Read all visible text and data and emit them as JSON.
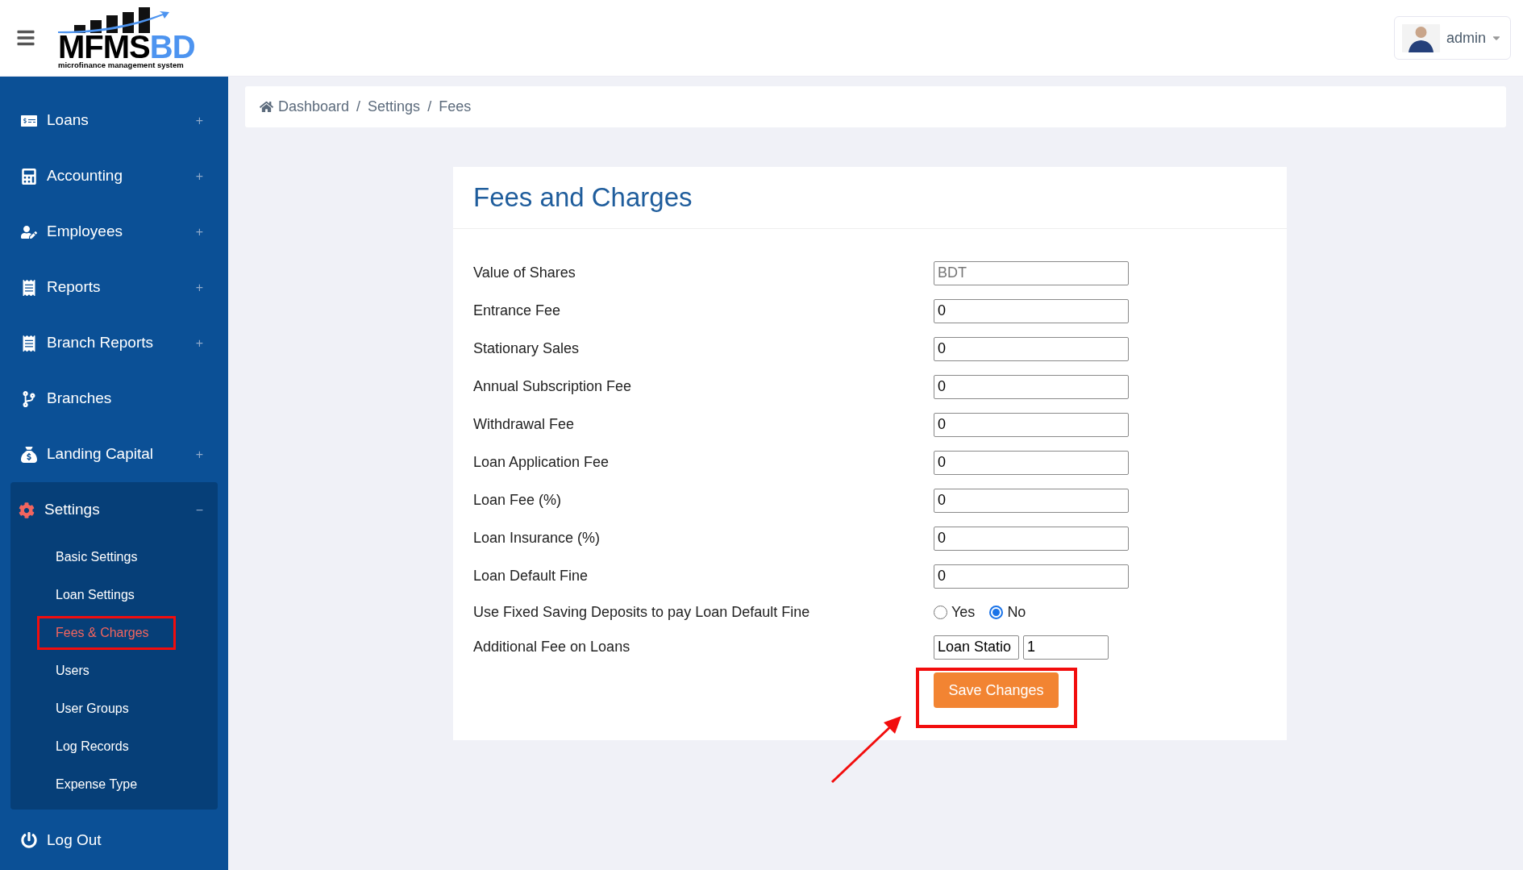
{
  "logo": {
    "name_dark": "MFMS",
    "name_accent": "BD",
    "tagline": "microfinance management system"
  },
  "user": {
    "name": "admin"
  },
  "sidebar": {
    "items": [
      {
        "label": "Loans",
        "toggle": "+",
        "expanded": false
      },
      {
        "label": "Accounting",
        "toggle": "+",
        "expanded": false
      },
      {
        "label": "Employees",
        "toggle": "+",
        "expanded": false
      },
      {
        "label": "Reports",
        "toggle": "+",
        "expanded": false
      },
      {
        "label": "Branch Reports",
        "toggle": "+",
        "expanded": false
      },
      {
        "label": "Branches",
        "expanded": false
      },
      {
        "label": "Landing Capital",
        "toggle": "+",
        "expanded": false
      },
      {
        "label": "Settings",
        "toggle": "−",
        "expanded": true,
        "children": [
          {
            "label": "Basic Settings",
            "selected": false,
            "highlighted": false
          },
          {
            "label": "Loan Settings",
            "selected": false,
            "highlighted": false
          },
          {
            "label": "Fees & Charges",
            "selected": true,
            "highlighted": true
          },
          {
            "label": "Users",
            "selected": false,
            "highlighted": false
          },
          {
            "label": "User Groups",
            "selected": false,
            "highlighted": false
          },
          {
            "label": "Log Records",
            "selected": false,
            "highlighted": false
          },
          {
            "label": "Expense Type",
            "selected": false,
            "highlighted": false
          }
        ]
      }
    ],
    "logout": "Log Out"
  },
  "breadcrumb": {
    "items": [
      "Dashboard",
      "Settings",
      "Fees"
    ],
    "separator": "/"
  },
  "card": {
    "title": "Fees and Charges",
    "rows": [
      {
        "kind": "input",
        "label": "Value of Shares",
        "placeholder": "BDT"
      },
      {
        "kind": "input",
        "label": "Entrance Fee",
        "value": "0"
      },
      {
        "kind": "input",
        "label": "Stationary Sales",
        "value": "0"
      },
      {
        "kind": "input",
        "label": "Annual Subscription Fee",
        "value": "0"
      },
      {
        "kind": "input",
        "label": "Withdrawal Fee",
        "value": "0"
      },
      {
        "kind": "input",
        "label": "Loan Application Fee",
        "value": "0"
      },
      {
        "kind": "input",
        "label": "Loan Fee (%)",
        "value": "0"
      },
      {
        "kind": "input",
        "label": "Loan Insurance (%)",
        "value": "0"
      },
      {
        "kind": "input",
        "label": "Loan Default Fine",
        "value": "0"
      },
      {
        "kind": "radio",
        "label": "Use Fixed Saving Deposits to pay Loan Default Fine",
        "options": [
          {
            "label": "Yes",
            "selected": false
          },
          {
            "label": "No",
            "selected": true
          }
        ]
      },
      {
        "kind": "pair",
        "label": "Additional Fee on Loans",
        "values": [
          "Loan Statio",
          "1"
        ]
      }
    ],
    "save_button": {
      "label": "Save Changes",
      "highlighted": true,
      "pointer_arrow": true
    }
  }
}
